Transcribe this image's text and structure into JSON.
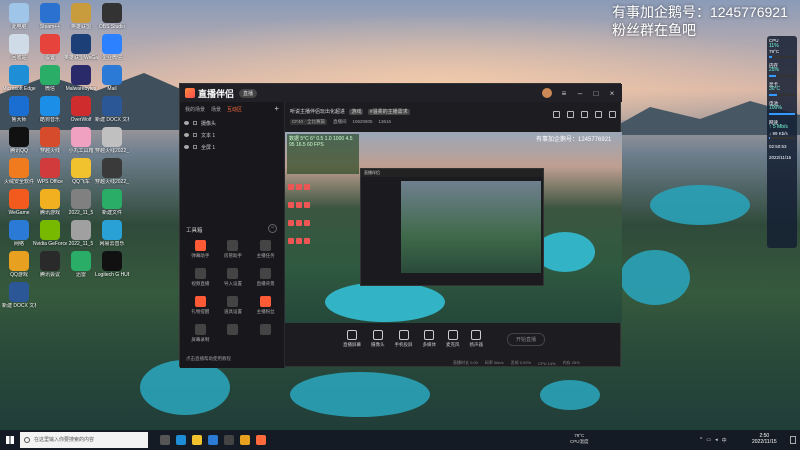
{
  "overlay": {
    "line1": "有事加企鹅号：1245776921",
    "line2": "粉丝群在鱼吧"
  },
  "desktop_icons": [
    {
      "label": "此电脑",
      "color": "#9fc6e8"
    },
    {
      "label": "Steam++",
      "color": "#2a71d0"
    },
    {
      "label": "英雄联盟",
      "color": "#c89b3c"
    },
    {
      "label": "OBS Studio",
      "color": "#333333"
    },
    {
      "label": "回收站",
      "color": "#cfdce8"
    },
    {
      "label": "设置",
      "color": "#e5433c"
    },
    {
      "label": "英雄联盟WeGame版",
      "color": "#1c3f78"
    },
    {
      "label": "企业微信",
      "color": "#2b81ff"
    },
    {
      "label": "Microsoft Edge",
      "color": "#1e8fd6"
    },
    {
      "label": "微信",
      "color": "#2aae67"
    },
    {
      "label": "Malwarebytes",
      "color": "#2a2a6a"
    },
    {
      "label": "Mail",
      "color": "#2b7ad6"
    },
    {
      "label": "鲁大师",
      "color": "#1b6ed1"
    },
    {
      "label": "酷狗音乐",
      "color": "#1b8ee8"
    },
    {
      "label": "OverWolf",
      "color": "#cf2d2d"
    },
    {
      "label": "新建 DOCX 文档",
      "color": "#2b5797"
    },
    {
      "label": "腾讯QQ",
      "color": "#111111"
    },
    {
      "label": "穿越火线",
      "color": "#d64b2b"
    },
    {
      "label": "小丸工具箱",
      "color": "#f0a0c0"
    },
    {
      "label": "穿越火线2022_1_5",
      "color": "#c0c0c0"
    },
    {
      "label": "火绒安全软件",
      "color": "#f07a1e"
    },
    {
      "label": "WPS Office",
      "color": "#d13b3b"
    },
    {
      "label": "QQ飞车",
      "color": "#f2c12e"
    },
    {
      "label": "穿越火线2022_11_5",
      "color": "#3a3a3a"
    },
    {
      "label": "WeGame",
      "color": "#f25a1e"
    },
    {
      "label": "腾讯游戏",
      "color": "#f0b020"
    },
    {
      "label": "2022_11_5",
      "color": "#808080"
    },
    {
      "label": "新建文件",
      "color": "#2aae67"
    },
    {
      "label": "网络",
      "color": "#2b7ad6"
    },
    {
      "label": "Nvidia GeForce",
      "color": "#76b900"
    },
    {
      "label": "2022_11_5",
      "color": "#a0a0a0"
    },
    {
      "label": "网易云音乐",
      "color": "#2aa1d6"
    },
    {
      "label": "QQ游戏",
      "color": "#e8a020"
    },
    {
      "label": "腾讯会议",
      "color": "#2a2a2a"
    },
    {
      "label": "迅雷",
      "color": "#2aae67"
    },
    {
      "label": "Logitech G HUB",
      "color": "#111111"
    },
    {
      "label": "新建 DOCX 文档",
      "color": "#2b5797"
    }
  ],
  "monitor": [
    {
      "title": "CPU",
      "value": "11%",
      "sub": "79°C",
      "fill": 0.11
    },
    {
      "title": "内存",
      "value": "25%",
      "sub": "",
      "fill": 0.25
    },
    {
      "title": "显卡",
      "value": "30°C",
      "sub": "",
      "fill": 0.3
    },
    {
      "title": "电池",
      "value": "100%",
      "sub": "",
      "fill": 1.0
    },
    {
      "title": "网速",
      "value": "↑ 5 Mb/s",
      "sub": "↓ 99 Kb/s",
      "fill": 0.05
    }
  ],
  "monitor_time": "02:50:53",
  "monitor_date": "2022/11/15",
  "app": {
    "name": "直播伴侣",
    "badge": "直播",
    "left_tabs": [
      "我的场景",
      "场景",
      "互动区"
    ],
    "scenes": [
      "摄像头",
      "文本 1",
      "全屏 1"
    ],
    "tools_title": "工具箱",
    "tools": [
      {
        "label": "弹幕助手",
        "hot": true
      },
      {
        "label": "房管助手",
        "hot": false
      },
      {
        "label": "主播任务",
        "hot": false
      },
      {
        "label": "视频直播",
        "hot": false
      },
      {
        "label": "导入设置",
        "hot": false
      },
      {
        "label": "直播背景",
        "hot": false
      },
      {
        "label": "礼物提醒",
        "hot": true
      },
      {
        "label": "道具设置",
        "hot": false
      },
      {
        "label": "主播粉丝",
        "hot": true
      },
      {
        "label": "屏幕录制",
        "hot": false
      },
      {
        "label": "",
        "hot": false
      },
      {
        "label": "",
        "hot": false
      }
    ],
    "left_footer": "点击直播帮助使用教程",
    "stream_title": "听说主播伴侣玩出化超进",
    "stream_tag1": "游戏",
    "stream_tag2": "#温柔的主播需求",
    "stream_info": [
      "CF40 · 全比赛篇",
      "直播间",
      "10620805",
      "13616"
    ],
    "preview_text": "有事加企鹅号：1245776921",
    "stats": "数据 5°C 6°  0.5  1.0  1000\n4.5  95  16.5  60  FPS",
    "controls": [
      {
        "label": "直播屏幕",
        "name": "screen-share"
      },
      {
        "label": "摄像头",
        "name": "camera"
      },
      {
        "label": "手机投屏",
        "name": "phone-cast"
      },
      {
        "label": "多媒体",
        "name": "media"
      },
      {
        "label": "麦克风",
        "name": "microphone"
      },
      {
        "label": "扬声器",
        "name": "speaker"
      }
    ],
    "start_label": "开始直播",
    "status": [
      "直播时长 0:00",
      "码率 0kb/s",
      "丢帧 0.00%",
      "CPU 14%",
      "内存 25%"
    ]
  },
  "taskbar": {
    "search_placeholder": "在这里输入你要搜索的内容",
    "cpu_temp": "79°C",
    "cpu_label": "CPU温度",
    "time": "2:50",
    "date": "2022/11/15",
    "lang": "中"
  }
}
